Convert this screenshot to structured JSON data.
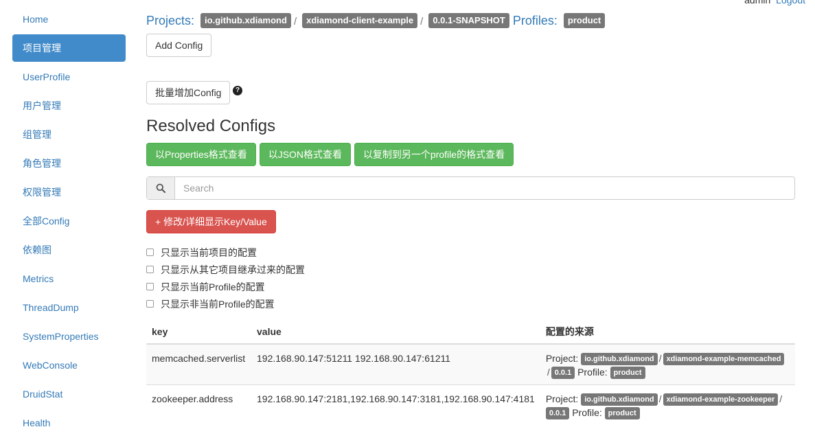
{
  "user": {
    "name": "admin",
    "logout": "Logout"
  },
  "sidebar": {
    "items": [
      {
        "label": "Home"
      },
      {
        "label": "项目管理",
        "active": true
      },
      {
        "label": "UserProfile"
      },
      {
        "label": "用户管理"
      },
      {
        "label": "组管理"
      },
      {
        "label": "角色管理"
      },
      {
        "label": "权限管理"
      },
      {
        "label": "全部Config"
      },
      {
        "label": "依赖图"
      },
      {
        "label": "Metrics"
      },
      {
        "label": "ThreadDump"
      },
      {
        "label": "SystemProperties"
      },
      {
        "label": "WebConsole"
      },
      {
        "label": "DruidStat"
      },
      {
        "label": "Health"
      }
    ]
  },
  "breadcrumb": {
    "projects_label": "Projects:",
    "group": "io.github.xdiamond",
    "artifact": "xdiamond-client-example",
    "version": "0.0.1-SNAPSHOT",
    "profiles_label": "Profiles:",
    "profile": "product",
    "separator": "/"
  },
  "buttons": {
    "add_config": "Add Config",
    "batch_add": "批量增加Config",
    "view_properties": "以Properties格式查看",
    "view_json": "以JSON格式查看",
    "view_copy": "以复制到另一个profile的格式查看",
    "edit_toggle": "+ 修改/详细显示Key/Value"
  },
  "help_icon": "question-circle-icon",
  "section_title": "Resolved Configs",
  "search": {
    "placeholder": "Search",
    "value": ""
  },
  "filters": [
    "只显示当前项目的配置",
    "只显示从其它项目继承过来的配置",
    "只显示当前Profile的配置",
    "只显示非当前Profile的配置"
  ],
  "table": {
    "headers": {
      "key": "key",
      "value": "value",
      "source": "配置的来源"
    },
    "rows": [
      {
        "key": "memcached.serverlist",
        "value": "192.168.90.147:51211 192.168.90.147:61211",
        "project_label": "Project:",
        "group": "io.github.xdiamond",
        "artifact": "xdiamond-example-memcached",
        "version": "0.0.1",
        "profile_label": "Profile:",
        "profile": "product"
      },
      {
        "key": "zookeeper.address",
        "value": "192.168.90.147:2181,192.168.90.147:3181,192.168.90.147:4181",
        "project_label": "Project:",
        "group": "io.github.xdiamond",
        "artifact": "xdiamond-example-zookeeper",
        "version": "0.0.1",
        "profile_label": "Profile:",
        "profile": "product"
      }
    ]
  },
  "colors": {
    "primary": "#428bca",
    "link": "#337ab7",
    "success": "#5cb85c",
    "danger": "#d9534f",
    "label": "#777777"
  }
}
